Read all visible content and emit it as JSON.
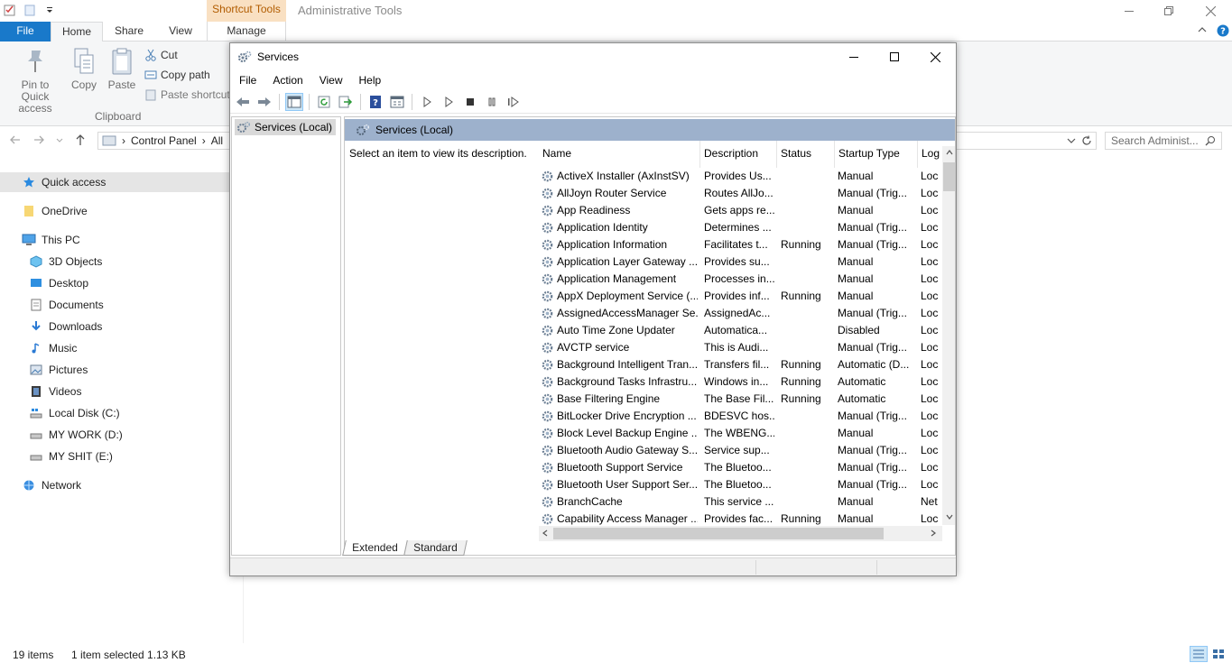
{
  "explorer": {
    "contextual_tab": "Shortcut Tools",
    "window_title": "Administrative Tools",
    "tabs": {
      "file": "File",
      "home": "Home",
      "share": "Share",
      "view": "View",
      "manage": "Manage"
    },
    "ribbon": {
      "pin_label_1": "Pin to Quick",
      "pin_label_2": "access",
      "copy_label": "Copy",
      "paste_label": "Paste",
      "cut_label": "Cut",
      "copy_path_label": "Copy path",
      "paste_shortcut_label": "Paste shortcut",
      "group_clipboard": "Clipboard"
    },
    "address": {
      "crumb_1": "Control Panel",
      "crumb_2": "All"
    },
    "search_placeholder": "Search Administ...",
    "nav": {
      "quick_access": "Quick access",
      "onedrive": "OneDrive",
      "this_pc": "This PC",
      "objects3d": "3D Objects",
      "desktop": "Desktop",
      "documents": "Documents",
      "downloads": "Downloads",
      "music": "Music",
      "pictures": "Pictures",
      "videos": "Videos",
      "local_disk": "Local Disk (C:)",
      "my_work": "MY WORK (D:)",
      "my_shit": "MY SHIT (E:)",
      "network": "Network"
    },
    "status": {
      "items": "19 items",
      "selected": "1 item selected  1.13 KB"
    }
  },
  "services": {
    "title": "Services",
    "menu": {
      "file": "File",
      "action": "Action",
      "view": "View",
      "help": "Help"
    },
    "tree_item": "Services (Local)",
    "header": "Services (Local)",
    "description_hint": "Select an item to view its description.",
    "columns": {
      "name": "Name",
      "description": "Description",
      "status": "Status",
      "startup": "Startup Type",
      "logon": "Log"
    },
    "rows": [
      {
        "name": "ActiveX Installer (AxInstSV)",
        "desc": "Provides Us...",
        "status": "",
        "startup": "Manual",
        "logon": "Loc"
      },
      {
        "name": "AllJoyn Router Service",
        "desc": "Routes AllJo...",
        "status": "",
        "startup": "Manual (Trig...",
        "logon": "Loc"
      },
      {
        "name": "App Readiness",
        "desc": "Gets apps re...",
        "status": "",
        "startup": "Manual",
        "logon": "Loc"
      },
      {
        "name": "Application Identity",
        "desc": "Determines ...",
        "status": "",
        "startup": "Manual (Trig...",
        "logon": "Loc"
      },
      {
        "name": "Application Information",
        "desc": "Facilitates t...",
        "status": "Running",
        "startup": "Manual (Trig...",
        "logon": "Loc"
      },
      {
        "name": "Application Layer Gateway ...",
        "desc": "Provides su...",
        "status": "",
        "startup": "Manual",
        "logon": "Loc"
      },
      {
        "name": "Application Management",
        "desc": "Processes in...",
        "status": "",
        "startup": "Manual",
        "logon": "Loc"
      },
      {
        "name": "AppX Deployment Service (...",
        "desc": "Provides inf...",
        "status": "Running",
        "startup": "Manual",
        "logon": "Loc"
      },
      {
        "name": "AssignedAccessManager Se...",
        "desc": "AssignedAc...",
        "status": "",
        "startup": "Manual (Trig...",
        "logon": "Loc"
      },
      {
        "name": "Auto Time Zone Updater",
        "desc": "Automatica...",
        "status": "",
        "startup": "Disabled",
        "logon": "Loc"
      },
      {
        "name": "AVCTP service",
        "desc": "This is Audi...",
        "status": "",
        "startup": "Manual (Trig...",
        "logon": "Loc"
      },
      {
        "name": "Background Intelligent Tran...",
        "desc": "Transfers fil...",
        "status": "Running",
        "startup": "Automatic (D...",
        "logon": "Loc"
      },
      {
        "name": "Background Tasks Infrastru...",
        "desc": "Windows in...",
        "status": "Running",
        "startup": "Automatic",
        "logon": "Loc"
      },
      {
        "name": "Base Filtering Engine",
        "desc": "The Base Fil...",
        "status": "Running",
        "startup": "Automatic",
        "logon": "Loc"
      },
      {
        "name": "BitLocker Drive Encryption ...",
        "desc": "BDESVC hos...",
        "status": "",
        "startup": "Manual (Trig...",
        "logon": "Loc"
      },
      {
        "name": "Block Level Backup Engine ...",
        "desc": "The WBENG...",
        "status": "",
        "startup": "Manual",
        "logon": "Loc"
      },
      {
        "name": "Bluetooth Audio Gateway S...",
        "desc": "Service sup...",
        "status": "",
        "startup": "Manual (Trig...",
        "logon": "Loc"
      },
      {
        "name": "Bluetooth Support Service",
        "desc": "The Bluetoo...",
        "status": "",
        "startup": "Manual (Trig...",
        "logon": "Loc"
      },
      {
        "name": "Bluetooth User Support Ser...",
        "desc": "The Bluetoo...",
        "status": "",
        "startup": "Manual (Trig...",
        "logon": "Loc"
      },
      {
        "name": "BranchCache",
        "desc": "This service ...",
        "status": "",
        "startup": "Manual",
        "logon": "Net"
      },
      {
        "name": "Capability Access Manager ...",
        "desc": "Provides fac...",
        "status": "Running",
        "startup": "Manual",
        "logon": "Loc"
      }
    ],
    "tabs": {
      "extended": "Extended",
      "standard": "Standard"
    }
  }
}
